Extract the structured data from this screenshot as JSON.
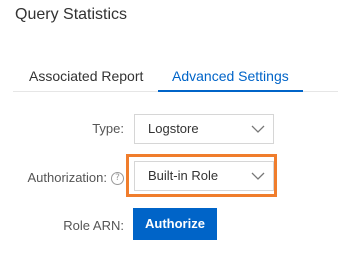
{
  "page": {
    "title": "Query Statistics"
  },
  "tabs": [
    {
      "label": "Associated Report",
      "active": false
    },
    {
      "label": "Advanced Settings",
      "active": true
    }
  ],
  "form": {
    "type": {
      "label": "Type:",
      "value": "Logstore"
    },
    "authorization": {
      "label": "Authorization:",
      "help_icon": "question-circle-icon",
      "value": "Built-in Role"
    },
    "role_arn": {
      "label": "Role ARN:",
      "button_label": "Authorize"
    }
  },
  "colors": {
    "accent": "#0064c8",
    "highlight": "#f07d2c",
    "text": "#333333"
  }
}
